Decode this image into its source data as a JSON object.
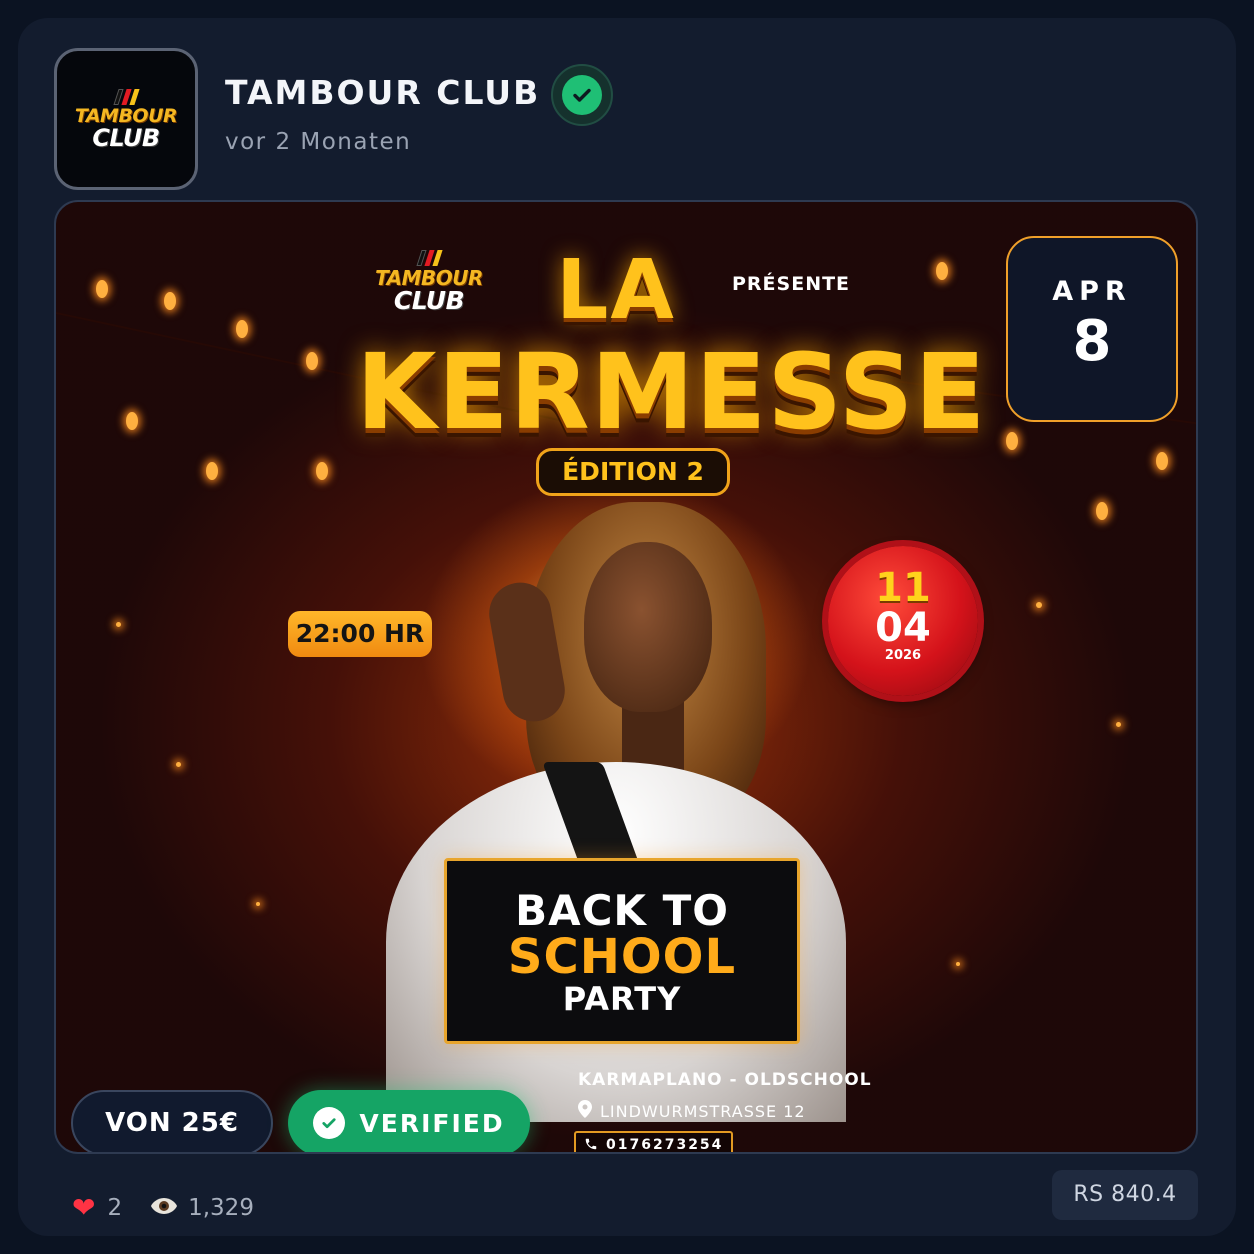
{
  "header": {
    "avatar_logo_top": "TAMBOUR",
    "avatar_logo_bottom": "CLUB",
    "club_name": "TAMBOUR CLUB",
    "timestamp": "vor 2 Monaten",
    "verified_icon": "check-circle-icon"
  },
  "poster": {
    "logo_top": "TAMBOUR",
    "logo_bottom": "CLUB",
    "presente": "PRÉSENTE",
    "title_line1": "LA",
    "title_line2": "KERMESSE",
    "edition": "ÉDITION 2",
    "time": "22:00 HR",
    "seal_day": "11",
    "seal_month": "04",
    "seal_year": "2026",
    "banner_line1": "BACK TO",
    "banner_line2": "SCHOOL",
    "banner_line3": "PARTY",
    "venue": "KARMAPLANO - OLDSCHOOL",
    "address": "LINDWURMSTRASSE 12",
    "phone": "0176273254"
  },
  "date_tile": {
    "month": "APR",
    "day": "8"
  },
  "price_pill": "VON 25€",
  "verified_pill": "VERIFIED",
  "footer": {
    "likes": "2",
    "views": "1,329",
    "price": "RS 840.4"
  },
  "colors": {
    "accent_gold": "#ffc21c",
    "verified_green": "#15a465",
    "card_bg": "#131c2e"
  }
}
